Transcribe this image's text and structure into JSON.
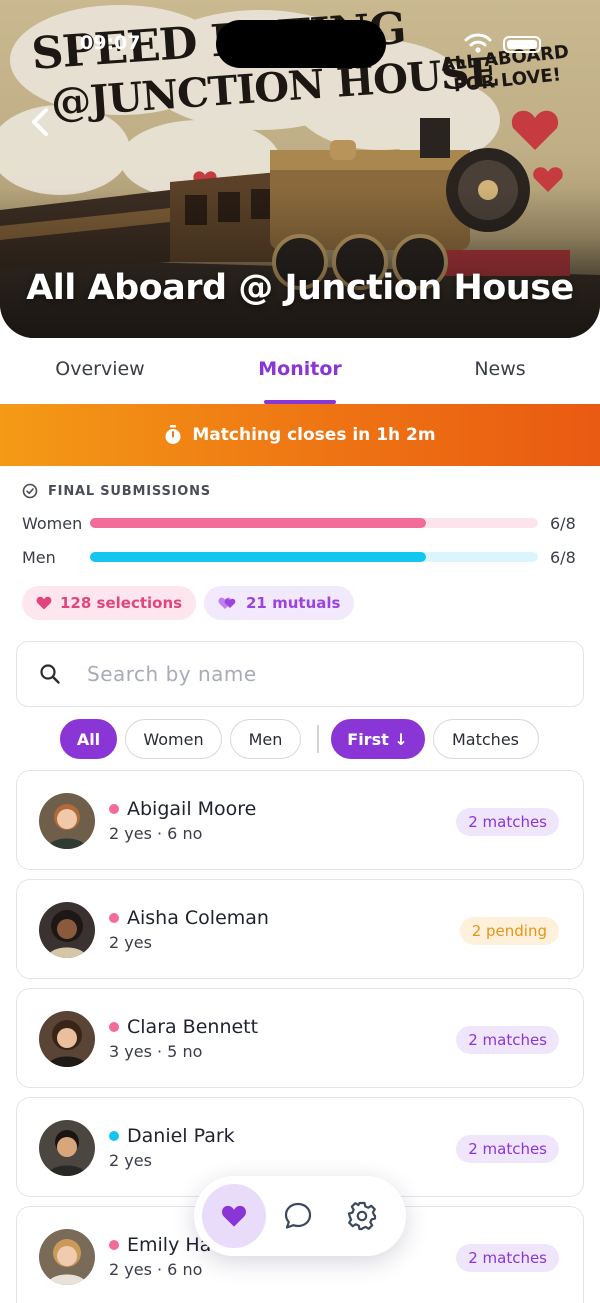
{
  "status_bar": {
    "time": "09:07"
  },
  "hero": {
    "poster_line1": "SPEED DATING",
    "poster_line2": "@JUNCTION HOUSE",
    "poster_tag_line1": "ALL ABOARD",
    "poster_tag_line2": "FOR LOVE!",
    "title": "All Aboard @ Junction House"
  },
  "tabs": [
    {
      "label": "Overview",
      "active": false
    },
    {
      "label": "Monitor",
      "active": true
    },
    {
      "label": "News",
      "active": false
    }
  ],
  "banner": {
    "icon": "stopwatch-icon",
    "text": "Matching closes in 1h 2m"
  },
  "submissions": {
    "heading": "FINAL SUBMISSIONS",
    "rows": [
      {
        "label": "Women",
        "value": "6/8",
        "fraction": 0.75,
        "color": "#f36b98",
        "track": "#fde3ec"
      },
      {
        "label": "Men",
        "value": "6/8",
        "fraction": 0.75,
        "color": "#12c6f0",
        "track": "#dbf5fc"
      }
    ],
    "selections": "128 selections",
    "mutuals": "21 mutuals"
  },
  "search": {
    "placeholder": "Search by name",
    "value": ""
  },
  "filters": {
    "all": "All",
    "women": "Women",
    "men": "Men",
    "sort": "First ↓",
    "matches": "Matches"
  },
  "people": [
    {
      "name": "Abigail Moore",
      "stats": "2 yes · 6 no",
      "gender": "woman",
      "badge": "2 matches",
      "badge_type": "match"
    },
    {
      "name": "Aisha Coleman",
      "stats": "2 yes",
      "gender": "woman",
      "badge": "2 pending",
      "badge_type": "pending"
    },
    {
      "name": "Clara Bennett",
      "stats": "3 yes · 5 no",
      "gender": "woman",
      "badge": "2 matches",
      "badge_type": "match"
    },
    {
      "name": "Daniel Park",
      "stats": "2 yes",
      "gender": "man",
      "badge": "2 matches",
      "badge_type": "match"
    },
    {
      "name": "Emily Ha",
      "stats": "2 yes · 6 no",
      "gender": "woman",
      "badge": "2 matches",
      "badge_type": "match"
    }
  ],
  "colors": {
    "accent": "#8a35d6",
    "women_dot": "#f36b98",
    "men_dot": "#12c6f0",
    "banner": "#ee7413"
  },
  "bottom_nav": [
    {
      "icon": "heart-icon",
      "active": true
    },
    {
      "icon": "chat-bubble-icon",
      "active": false
    },
    {
      "icon": "settings-gear-icon",
      "active": false
    }
  ]
}
